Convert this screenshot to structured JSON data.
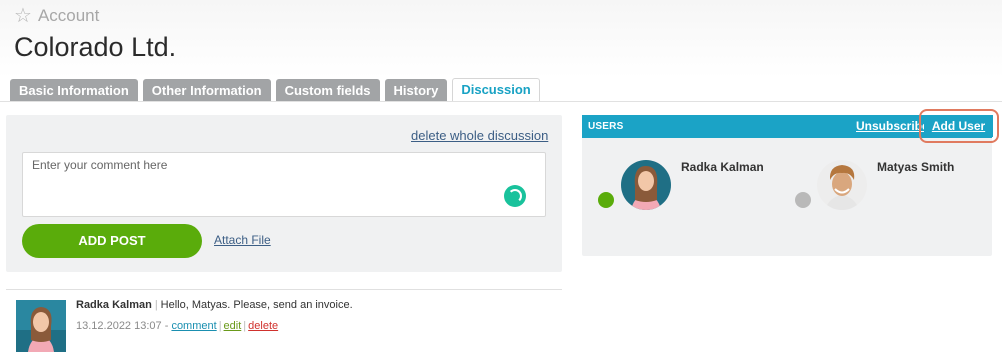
{
  "breadcrumb": {
    "icon": "star-icon",
    "label": "Account"
  },
  "page_title": "Colorado Ltd.",
  "tabs": [
    {
      "label": "Basic Information",
      "active": false
    },
    {
      "label": "Other Information",
      "active": false
    },
    {
      "label": "Custom fields",
      "active": false
    },
    {
      "label": "History",
      "active": false
    },
    {
      "label": "Discussion",
      "active": true
    }
  ],
  "discussion": {
    "delete_whole_label": "delete whole discussion",
    "comment_placeholder": "Enter your comment here",
    "add_post_label": "ADD POST",
    "attach_file_label": "Attach File"
  },
  "posts": [
    {
      "author": "Radka Kalman",
      "text": "Hello, Matyas. Please, send an invoice.",
      "timestamp": "13.12.2022 13:07",
      "dash": "-",
      "comment_label": "comment",
      "edit_label": "edit",
      "delete_label": "delete"
    }
  ],
  "users": {
    "title": "USERS",
    "unsubscribe_label": "Unsubscribe",
    "add_user_label": "Add User",
    "list": [
      {
        "name": "Radka Kalman",
        "status": "online",
        "status_color": "#5aac0b"
      },
      {
        "name": "Matyas Smith",
        "status": "offline",
        "status_color": "#b9b9b9"
      }
    ]
  },
  "colors": {
    "accent": "#1ba3c6",
    "button_green": "#5aac0b",
    "tab_inactive": "#a2a4a6",
    "highlight_outline": "#e07a5f"
  }
}
